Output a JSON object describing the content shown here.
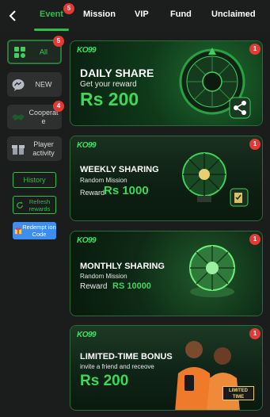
{
  "header": {
    "tabs": [
      {
        "label": "Event",
        "badge": "5"
      },
      {
        "label": "Mission"
      },
      {
        "label": "VIP"
      },
      {
        "label": "Fund"
      },
      {
        "label": "Unclaimed"
      }
    ]
  },
  "sidebar": {
    "items": [
      {
        "label": "All",
        "badge": "5",
        "icon": "grid-icon"
      },
      {
        "label": "NEW",
        "icon": "messenger-icon"
      },
      {
        "label": "Cooperat e",
        "badge": "4",
        "icon": "handshake-icon"
      },
      {
        "label": "Player activity",
        "icon": "gift-icon"
      }
    ],
    "history_label": "History",
    "refresh_label": "Refresh rewards",
    "redemption_label": "Redempt ion Code"
  },
  "banners": [
    {
      "logo": "KO99",
      "title": "DAILY SHARE",
      "subtitle": "Get your reward",
      "amount": "Rs 200",
      "badge": "1"
    },
    {
      "logo": "KO99",
      "title": "WEEKLY SHARING",
      "subtitle": "Random Mission",
      "reward_label": "Reward",
      "amount": "Rs 1000",
      "badge": "1"
    },
    {
      "logo": "KO99",
      "title": "MONTHLY SHARING",
      "subtitle": "Random Mission",
      "reward_label": "Reward",
      "amount": "RS 10000",
      "badge": "1"
    },
    {
      "logo": "KO99",
      "title": "LIMITED-TIME BONUS",
      "subtitle": "invite a friend and receove",
      "amount": "Rs 200",
      "badge": "1",
      "stamp": "LIMITED TIME"
    }
  ],
  "colors": {
    "accent": "#2fbf4a",
    "badge": "#e53935",
    "background": "#1b1d1c"
  }
}
